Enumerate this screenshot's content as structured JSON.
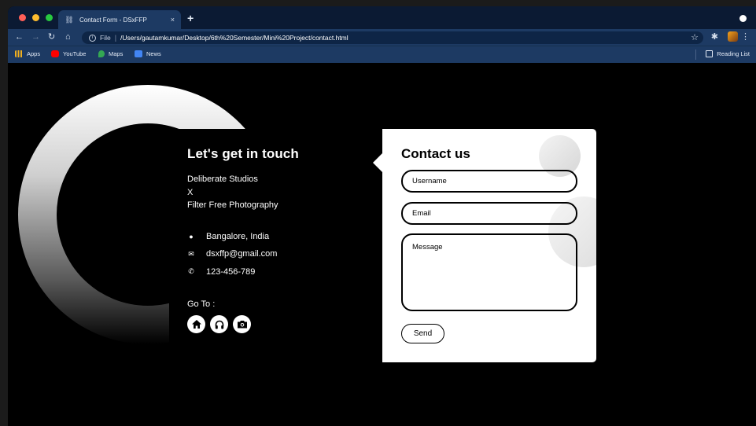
{
  "browser": {
    "tab_title": "Contact Form - DSxFFP",
    "tab_close": "×",
    "new_tab": "+",
    "scheme_label": "File",
    "separator": "|",
    "url": "/Users/gautamkumar/Desktop/6th%20Semester/Mini%20Project/contact.html",
    "bookmarks": [
      {
        "label": "Apps",
        "icon": "apps-grid-icon",
        "color": "#f2b01e"
      },
      {
        "label": "YouTube",
        "icon": "youtube-icon",
        "color": "#ff0000"
      },
      {
        "label": "Maps",
        "icon": "maps-icon",
        "color": "#34a853"
      },
      {
        "label": "News",
        "icon": "news-icon",
        "color": "#4285f4"
      }
    ],
    "reading_list": "Reading List"
  },
  "info": {
    "title": "Let's get in touch",
    "company_line1": "Deliberate Studios",
    "company_line2": "X",
    "company_line3": "Filter Free Photography",
    "contacts": [
      {
        "icon": "location-pin-icon",
        "text": "Bangalore, India"
      },
      {
        "icon": "envelope-icon",
        "text": "dsxffp@gmail.com"
      },
      {
        "icon": "phone-icon",
        "text": "123-456-789"
      }
    ],
    "goto_label": "Go To :",
    "social": [
      "home-icon",
      "headphones-icon",
      "camera-icon"
    ]
  },
  "form": {
    "title": "Contact us",
    "username_placeholder": "Username",
    "email_placeholder": "Email",
    "message_placeholder": "Message",
    "send_label": "Send"
  }
}
